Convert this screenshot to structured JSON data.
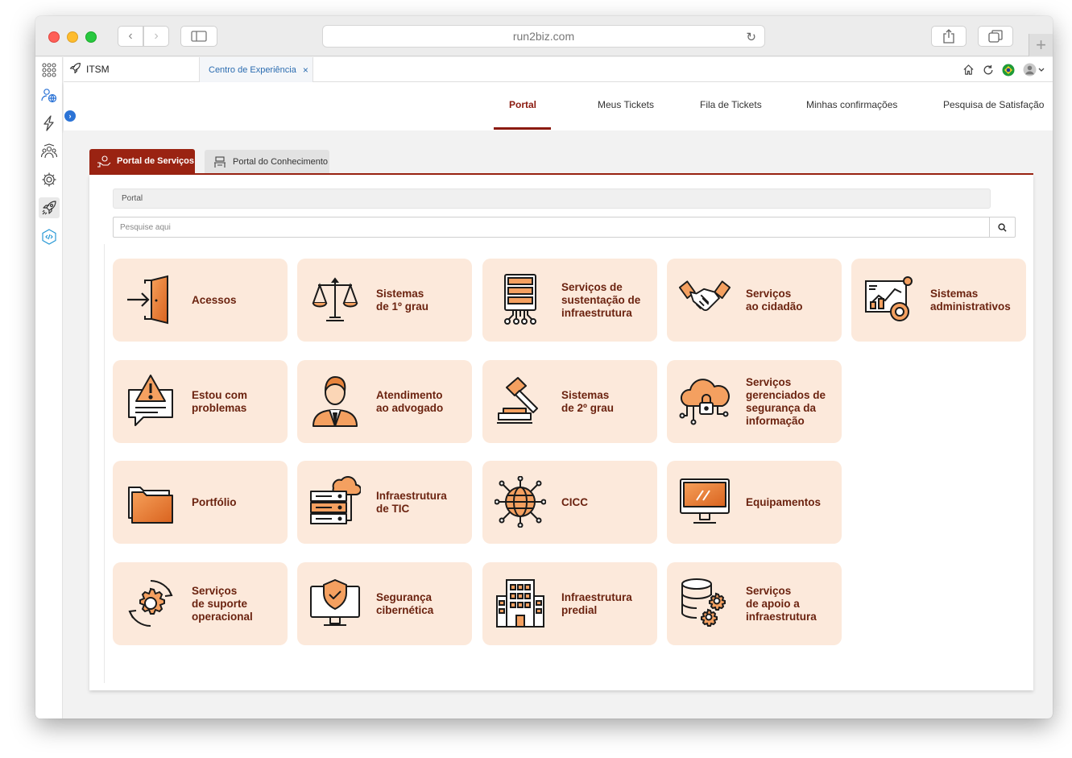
{
  "browser": {
    "url": "run2biz.com"
  },
  "app": {
    "title": "ITSM",
    "open_tab": "Centro de Experiência",
    "close_symbol": "×"
  },
  "nav": {
    "tabs": [
      {
        "label": "Portal",
        "active": true
      },
      {
        "label": "Meus Tickets"
      },
      {
        "label": "Fila de Tickets"
      },
      {
        "label": "Minhas confirmações"
      },
      {
        "label": "Pesquisa de Satisfação"
      }
    ]
  },
  "portal": {
    "tab_services": "Portal de Serviços",
    "tab_knowledge": "Portal do Conhecimento",
    "breadcrumb": "Portal",
    "search_placeholder": "Pesquise aqui"
  },
  "colors": {
    "brand": "#9a2312",
    "tile_bg": "#fce9db",
    "tile_text": "#6b2310",
    "icon_orange": "#e8843c"
  },
  "tiles": [
    {
      "label": "Acessos",
      "icon": "door-enter-icon"
    },
    {
      "label": "Sistemas\nde 1º grau",
      "icon": "scales-icon"
    },
    {
      "label": "Serviços de\nsustentação de\ninfraestrutura",
      "icon": "server-rack-icon"
    },
    {
      "label": "Serviços\nao cidadão",
      "icon": "handshake-icon"
    },
    {
      "label": "Sistemas\nadministrativos",
      "icon": "dashboard-analytics-icon"
    },
    {
      "label": "Estou com\nproblemas",
      "icon": "warning-chat-icon"
    },
    {
      "label": "Atendimento\nao advogado",
      "icon": "lawyer-icon"
    },
    {
      "label": "Sistemas\nde 2º grau",
      "icon": "gavel-icon"
    },
    {
      "label": "Serviços\ngerenciados de\nsegurança da\ninformação",
      "icon": "cloud-lock-icon"
    },
    {
      "label": "Portfólio",
      "icon": "folder-icon"
    },
    {
      "label": "Infraestrutura\nde TIC",
      "icon": "server-cloud-icon"
    },
    {
      "label": "CICC",
      "icon": "globe-network-icon"
    },
    {
      "label": "Equipamentos",
      "icon": "monitor-icon"
    },
    {
      "label": "Serviços\nde suporte\noperacional",
      "icon": "gear-cycle-icon"
    },
    {
      "label": "Segurança\ncibernética",
      "icon": "shield-monitor-icon"
    },
    {
      "label": "Infraestrutura\npredial",
      "icon": "building-icon"
    },
    {
      "label": "Serviços\nde apoio a\ninfraestrutura",
      "icon": "database-gears-icon"
    }
  ]
}
